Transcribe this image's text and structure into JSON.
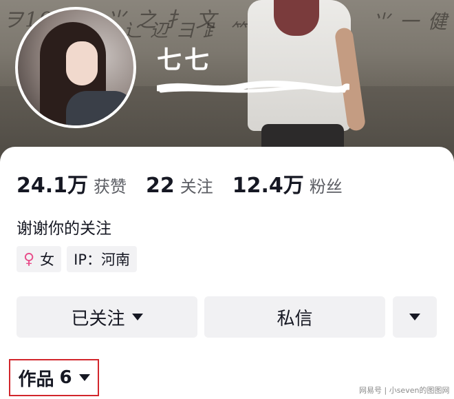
{
  "profile": {
    "name": "七七",
    "bio": "谢谢你的关注"
  },
  "stats": [
    {
      "value": "24.1万",
      "label": "获赞"
    },
    {
      "value": "22",
      "label": "关注"
    },
    {
      "value": "12.4万",
      "label": "粉丝"
    }
  ],
  "tags": {
    "gender": "女",
    "gender_icon": "♀",
    "ip": "IP：河南"
  },
  "actions": {
    "follow_label": "已关注",
    "message_label": "私信"
  },
  "works_tab": {
    "label": "作品",
    "count": "6"
  },
  "watermark": "网易号 | 小seven的图图网",
  "colors": {
    "highlight_border": "#d2252b",
    "female_icon": "#e84d8a"
  }
}
